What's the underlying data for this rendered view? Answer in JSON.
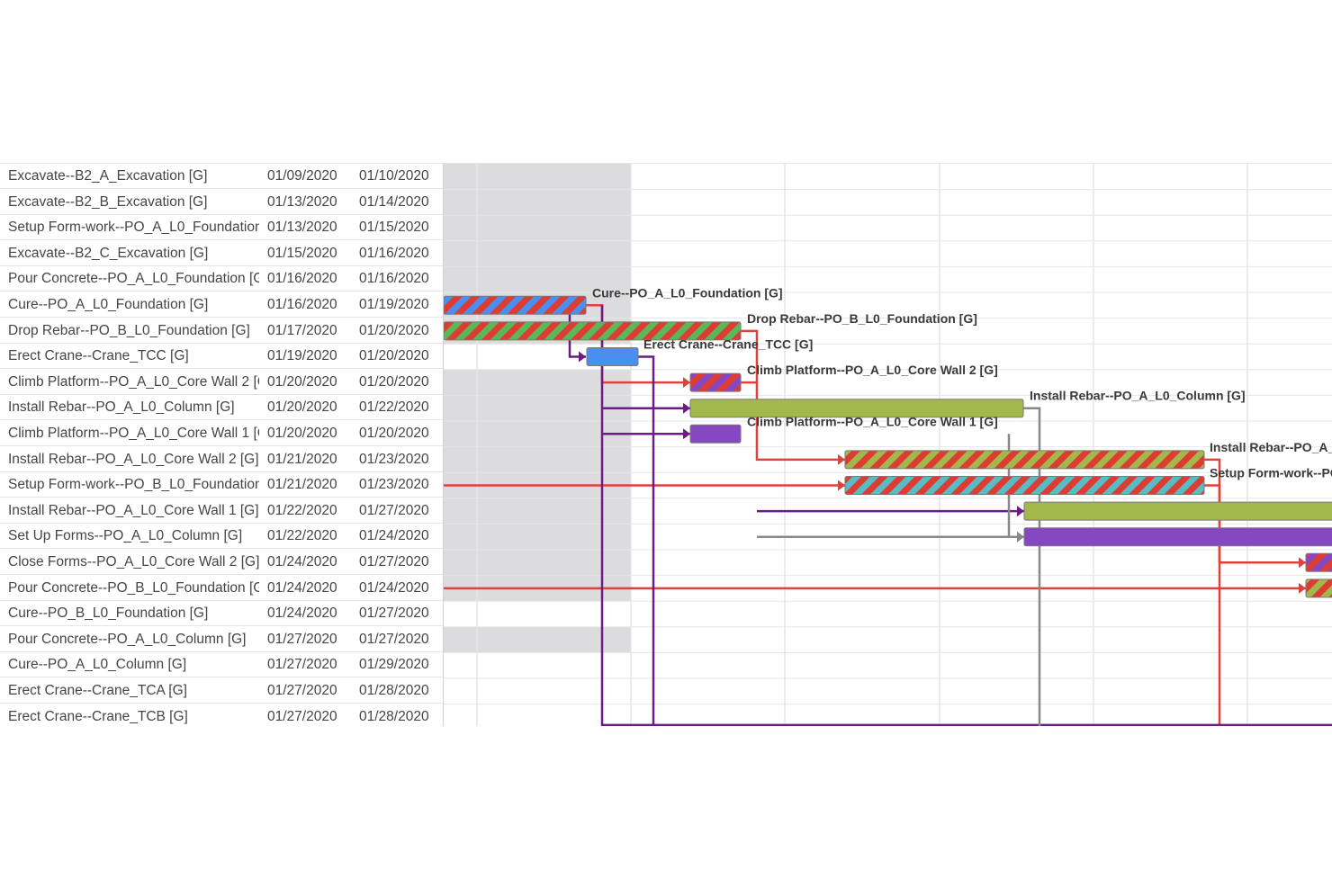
{
  "tasks": [
    {
      "name": "Excavate--B2_A_Excavation [G]",
      "start": "01/09/2020",
      "end": "01/10/2020"
    },
    {
      "name": "Excavate--B2_B_Excavation [G]",
      "start": "01/13/2020",
      "end": "01/14/2020"
    },
    {
      "name": "Setup Form-work--PO_A_L0_Foundation",
      "start": "01/13/2020",
      "end": "01/15/2020"
    },
    {
      "name": "Excavate--B2_C_Excavation [G]",
      "start": "01/15/2020",
      "end": "01/16/2020"
    },
    {
      "name": "Pour Concrete--PO_A_L0_Foundation [G",
      "start": "01/16/2020",
      "end": "01/16/2020"
    },
    {
      "name": "Cure--PO_A_L0_Foundation [G]",
      "start": "01/16/2020",
      "end": "01/19/2020"
    },
    {
      "name": "Drop Rebar--PO_B_L0_Foundation [G]",
      "start": "01/17/2020",
      "end": "01/20/2020"
    },
    {
      "name": "Erect Crane--Crane_TCC [G]",
      "start": "01/19/2020",
      "end": "01/20/2020"
    },
    {
      "name": "Climb Platform--PO_A_L0_Core Wall 2 [C",
      "start": "01/20/2020",
      "end": "01/20/2020"
    },
    {
      "name": "Install Rebar--PO_A_L0_Column [G]",
      "start": "01/20/2020",
      "end": "01/22/2020"
    },
    {
      "name": "Climb Platform--PO_A_L0_Core Wall 1 [C",
      "start": "01/20/2020",
      "end": "01/20/2020"
    },
    {
      "name": "Install Rebar--PO_A_L0_Core Wall 2 [G]",
      "start": "01/21/2020",
      "end": "01/23/2020"
    },
    {
      "name": "Setup Form-work--PO_B_L0_Foundation",
      "start": "01/21/2020",
      "end": "01/23/2020"
    },
    {
      "name": "Install Rebar--PO_A_L0_Core Wall 1 [G]",
      "start": "01/22/2020",
      "end": "01/27/2020"
    },
    {
      "name": "Set Up Forms--PO_A_L0_Column [G]",
      "start": "01/22/2020",
      "end": "01/24/2020"
    },
    {
      "name": "Close Forms--PO_A_L0_Core Wall 2 [G]",
      "start": "01/24/2020",
      "end": "01/27/2020"
    },
    {
      "name": "Pour Concrete--PO_B_L0_Foundation [G",
      "start": "01/24/2020",
      "end": "01/24/2020"
    },
    {
      "name": "Cure--PO_B_L0_Foundation [G]",
      "start": "01/24/2020",
      "end": "01/27/2020"
    },
    {
      "name": "Pour Concrete--PO_A_L0_Column [G]",
      "start": "01/27/2020",
      "end": "01/27/2020"
    },
    {
      "name": "Cure--PO_A_L0_Column [G]",
      "start": "01/27/2020",
      "end": "01/29/2020"
    },
    {
      "name": "Erect Crane--Crane_TCA [G]",
      "start": "01/27/2020",
      "end": "01/28/2020"
    },
    {
      "name": "Erect Crane--Crane_TCB [G]",
      "start": "01/27/2020",
      "end": "01/28/2020"
    }
  ],
  "bar_labels": [
    {
      "row": 5,
      "text": "Cure--PO_A_L0_Foundation [G]"
    },
    {
      "row": 6,
      "text": "Drop Rebar--PO_B_L0_Foundation [G]"
    },
    {
      "row": 7,
      "text": "Erect Crane--Crane_TCC [G]"
    },
    {
      "row": 8,
      "text": "Climb Platform--PO_A_L0_Core Wall 2 [G]"
    },
    {
      "row": 9,
      "text": "Install Rebar--PO_A_L0_Column [G]"
    },
    {
      "row": 10,
      "text": "Climb Platform--PO_A_L0_Core Wall 1 [G]"
    },
    {
      "row": 11,
      "text": "Install Rebar--PO_A_L"
    },
    {
      "row": 12,
      "text": "Setup Form-work--PO"
    }
  ],
  "colors": {
    "blue": "#4a8ef0",
    "red": "#dd3c32",
    "green": "#5bb85a",
    "olive": "#a3b84a",
    "purple": "#8647c2",
    "teal": "#59bcc4",
    "link_red": "#e0413a",
    "link_purple": "#6e1a86",
    "link_gray": "#888888",
    "nonworking": "#dcdcde",
    "gridline": "#e6e6e6"
  }
}
